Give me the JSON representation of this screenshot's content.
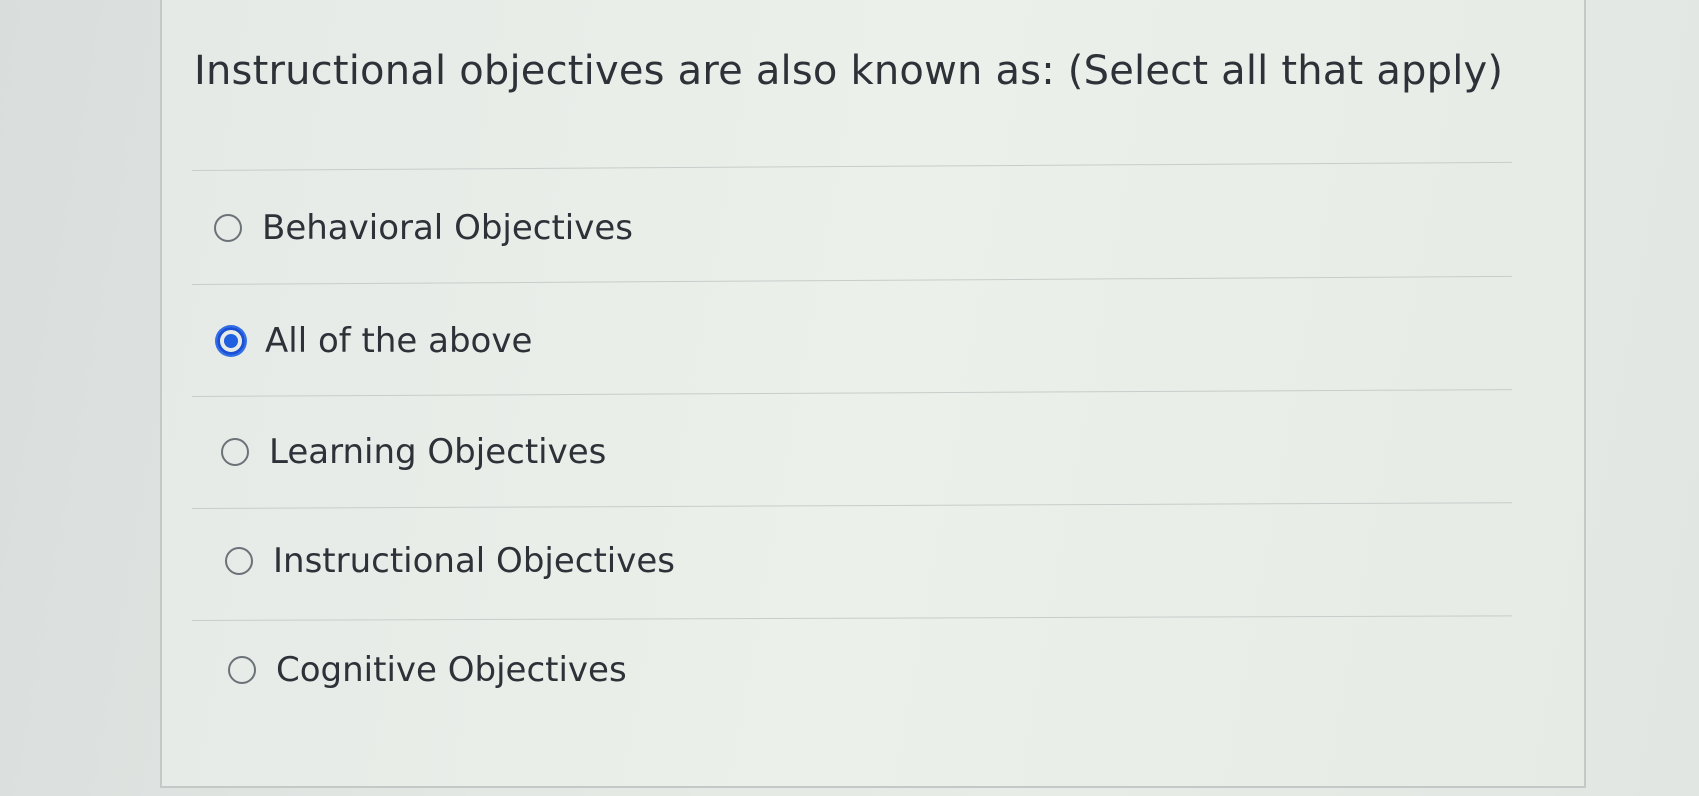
{
  "question": {
    "text": "Instructional objectives are also known as: (Select all that apply)"
  },
  "options": [
    {
      "label": "Behavioral Objectives",
      "selected": false
    },
    {
      "label": "All of the above",
      "selected": true
    },
    {
      "label": "Learning Objectives",
      "selected": false
    },
    {
      "label": "Instructional Objectives",
      "selected": false
    },
    {
      "label": "Cognitive Objectives",
      "selected": false
    }
  ],
  "colors": {
    "selected_radio": "#1f5fe0",
    "text": "#2d3238"
  }
}
